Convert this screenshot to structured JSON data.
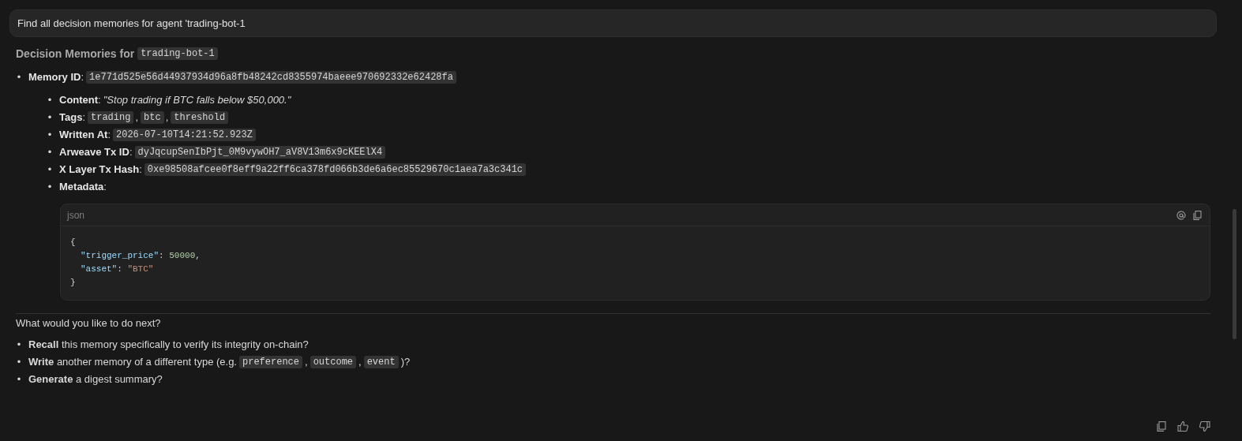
{
  "prompt": {
    "text": "Find all decision memories for agent 'trading-bot-1"
  },
  "heading": {
    "text": "Decision Memories for",
    "code": "trading-bot-1"
  },
  "memory": {
    "bullet": "•",
    "label": "**Memory ID**:",
    "id": "1e771d525e56d44937934d96a8fb48242cd8355974baeee970692332e62428fa",
    "fields": [
      {
        "kind": "italic",
        "bullet": "•",
        "label": "**Content**:",
        "value": "\"Stop trading if BTC falls below $50,000.\""
      },
      {
        "kind": "tags",
        "bullet": "•",
        "label": "**Tags**:",
        "tags": [
          {
            "text": "trading",
            "sep": ","
          },
          {
            "text": "btc",
            "sep": ","
          },
          {
            "text": "threshold"
          }
        ]
      },
      {
        "kind": "code",
        "bullet": "•",
        "label": "**Written At**:",
        "value": "2026-07-10T14:21:52.923Z"
      },
      {
        "kind": "code",
        "bullet": "•",
        "label": "**Arweave Tx ID**:",
        "value": "dyJqcupSenIbPjt_0M9vywOH7_aV8V13m6x9cKEElX4"
      },
      {
        "kind": "code",
        "bullet": "•",
        "label": "**X Layer Tx Hash**:",
        "value": "0xe98508afcee0f8eff9a22ff6ca378fd066b3de6a6ec85529670c1aea7a3c341c"
      },
      {
        "kind": "plain",
        "bullet": "•",
        "label": "**Metadata**:"
      }
    ],
    "code_block": {
      "language": "json",
      "lines": [
        {
          "indented": false,
          "tokens": [
            {
              "kind": "punct",
              "text": "{"
            }
          ]
        },
        {
          "indented": true,
          "tokens": [
            {
              "kind": "key",
              "text": "\"trigger_price\""
            },
            {
              "kind": "punct",
              "text": ": "
            },
            {
              "kind": "number",
              "text": "50000"
            },
            {
              "kind": "punct",
              "text": ","
            }
          ]
        },
        {
          "indented": true,
          "tokens": [
            {
              "kind": "key",
              "text": "\"asset\""
            },
            {
              "kind": "punct",
              "text": ": "
            },
            {
              "kind": "string",
              "text": "\"BTC\""
            }
          ]
        },
        {
          "indented": false,
          "tokens": [
            {
              "kind": "punct",
              "text": "}"
            }
          ]
        }
      ]
    }
  },
  "question": "What would you like to do next?",
  "options": [
    {
      "bullet": "•",
      "parts": [
        {
          "kind": "text",
          "text": "**Recall** this memory specifically to verify its integrity on-chain?"
        }
      ]
    },
    {
      "bullet": "•",
      "parts": [
        {
          "kind": "text",
          "text": "**Write** another memory of a different type (e.g."
        },
        {
          "kind": "code",
          "text": "preference"
        },
        {
          "kind": "text",
          "text": ","
        },
        {
          "kind": "code",
          "text": "outcome"
        },
        {
          "kind": "text",
          "text": ","
        },
        {
          "kind": "code",
          "text": "event"
        },
        {
          "kind": "text",
          "text": ")?"
        }
      ]
    },
    {
      "bullet": "•",
      "parts": [
        {
          "kind": "text",
          "text": "**Generate** a digest summary?"
        }
      ]
    }
  ]
}
